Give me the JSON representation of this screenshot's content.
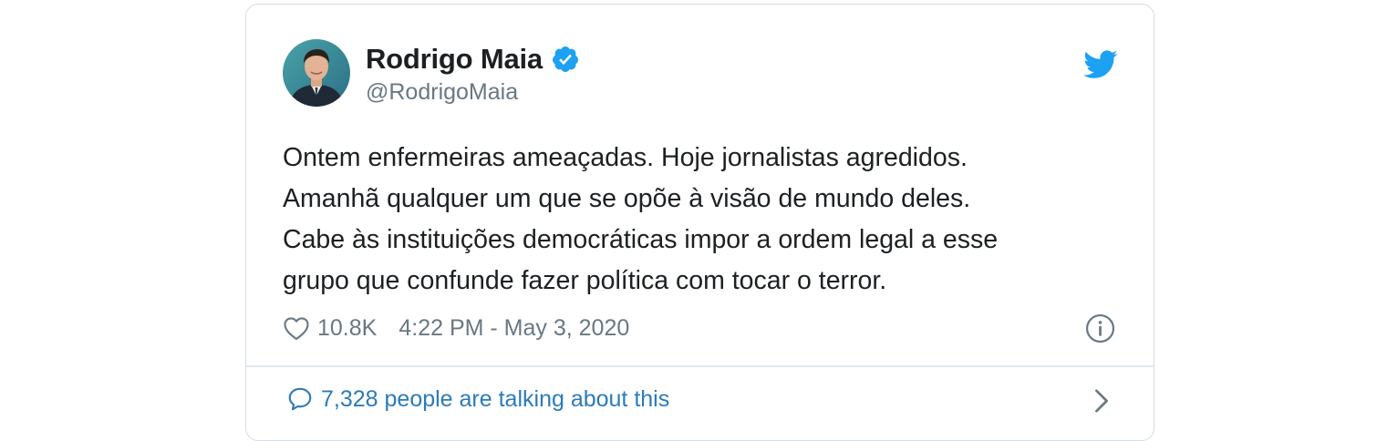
{
  "author": {
    "name": "Rodrigo Maia",
    "handle": "@RodrigoMaia",
    "verified_icon": "verified-badge-icon",
    "avatar_icon": "profile-avatar"
  },
  "tweet": {
    "lines": [
      "Ontem enfermeiras ameaçadas. Hoje jornalistas agredidos.",
      "Amanhã qualquer um que se opõe à visão de mundo deles.",
      "Cabe às instituições democráticas impor a ordem legal a esse",
      "grupo que confunde fazer política com tocar o terror."
    ]
  },
  "meta": {
    "like_count": "10.8K",
    "timestamp": "4:22 PM - May 3, 2020",
    "heart_icon": "heart-icon",
    "info_icon": "info-icon"
  },
  "footer": {
    "conversation_label": "7,328 people are talking about this",
    "bubble_icon": "speech-bubble-icon",
    "chevron_icon": "chevron-right-icon"
  },
  "colors": {
    "twitter_blue": "#1da1f2",
    "link_blue": "#2b7bb9",
    "text": "#1c2022",
    "muted": "#697882",
    "border": "#d4dde3"
  }
}
